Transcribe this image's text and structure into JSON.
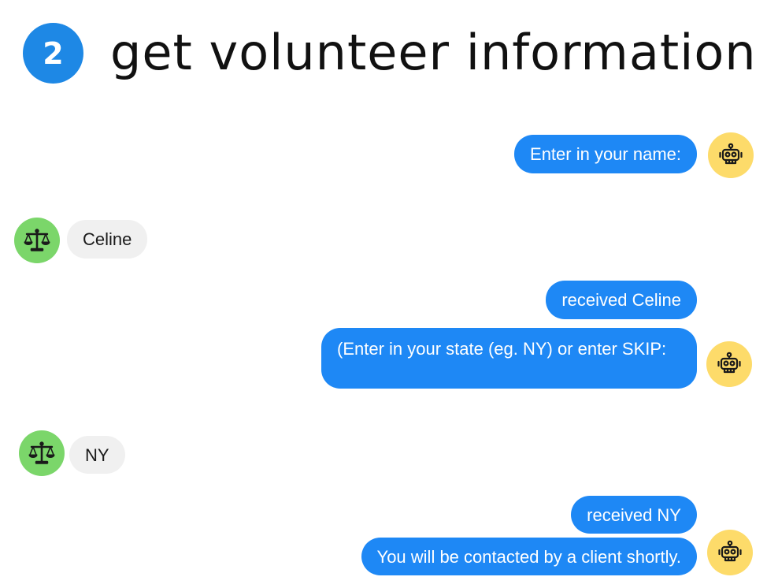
{
  "header": {
    "step_number": "2",
    "title": "get volunteer information"
  },
  "messages": [
    {
      "sender": "bot",
      "text": "Enter in your name:",
      "avatar_icon": "robot-icon"
    },
    {
      "sender": "user",
      "text": "Celine",
      "avatar_icon": "scales-icon"
    },
    {
      "sender": "bot",
      "text": "received Celine"
    },
    {
      "sender": "bot",
      "text": "(Enter in your state (eg. NY) or enter SKIP:",
      "avatar_icon": "robot-icon"
    },
    {
      "sender": "user",
      "text": "NY",
      "avatar_icon": "scales-icon"
    },
    {
      "sender": "bot",
      "text": "received NY"
    },
    {
      "sender": "bot",
      "text": "You will be contacted by a client shortly.",
      "avatar_icon": "robot-icon"
    }
  ],
  "colors": {
    "step_badge": "#1e88e5",
    "bot_bubble": "#1e88f5",
    "user_bubble": "#f0f0f0",
    "bot_avatar": "#fddb6a",
    "user_avatar": "#7bd66a"
  }
}
